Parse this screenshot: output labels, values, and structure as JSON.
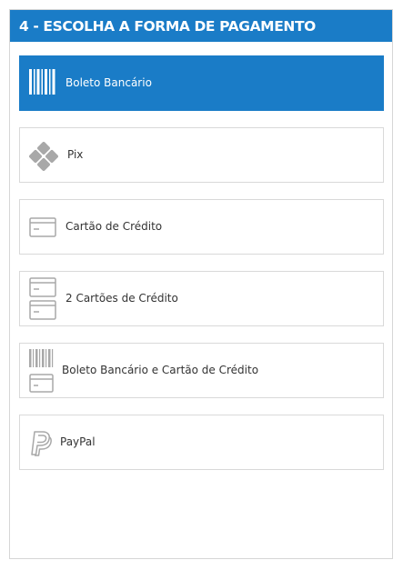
{
  "header": {
    "title": "4 - ESCOLHA A FORMA DE PAGAMENTO"
  },
  "colors": {
    "accent": "#1a7cc7",
    "icon_gray": "#a8a8a8",
    "border": "#d9d9d9"
  },
  "payment_options": [
    {
      "label": "Boleto Bancário",
      "icon": "barcode-icon",
      "selected": true
    },
    {
      "label": "Pix",
      "icon": "pix-icon",
      "selected": false
    },
    {
      "label": "Cartão de Crédito",
      "icon": "credit-card-icon",
      "selected": false
    },
    {
      "label": "2 Cartões de Crédito",
      "icon": "two-credit-cards-icon",
      "selected": false
    },
    {
      "label": "Boleto Bancário e Cartão de Crédito",
      "icon": "barcode-and-card-icon",
      "selected": false
    },
    {
      "label": "PayPal",
      "icon": "paypal-icon",
      "selected": false
    }
  ]
}
